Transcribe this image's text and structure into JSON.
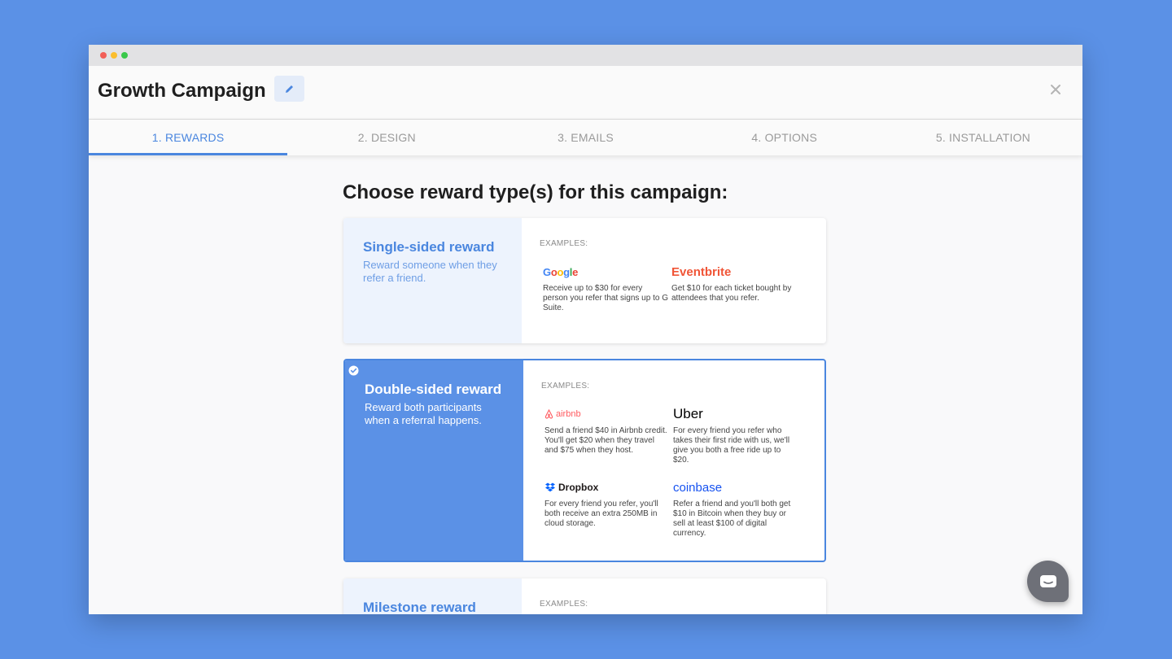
{
  "header": {
    "title": "Growth Campaign"
  },
  "tabs": [
    {
      "label": "1. REWARDS",
      "active": true
    },
    {
      "label": "2. DESIGN"
    },
    {
      "label": "3. EMAILS"
    },
    {
      "label": "4. OPTIONS"
    },
    {
      "label": "5. INSTALLATION"
    }
  ],
  "main": {
    "title": "Choose reward type(s) for this campaign:",
    "cards": [
      {
        "title": "Single-sided reward",
        "desc": "Reward someone when they refer a friend.",
        "examples_label": "EXAMPLES:",
        "examples": [
          {
            "brand": "Google",
            "text": "Receive up to $30 for every person you refer that signs up to G Suite."
          },
          {
            "brand": "Eventbrite",
            "text": "Get $10 for each ticket bought by attendees that you refer."
          }
        ]
      },
      {
        "title": "Double-sided reward",
        "desc": "Reward both participants when a referral happens.",
        "examples_label": "EXAMPLES:",
        "examples": [
          {
            "brand": "airbnb",
            "text": "Send a friend $40 in Airbnb credit. You'll get $20 when they travel and $75 when they host."
          },
          {
            "brand": "Uber",
            "text": "For every friend you refer who takes their first ride with us, we'll give you both a free ride up to $20."
          },
          {
            "brand": "Dropbox",
            "text": "For every friend you refer, you'll both receive an extra 250MB in cloud storage."
          },
          {
            "brand": "coinbase",
            "text": "Refer a friend and you'll both get $10 in Bitcoin when they buy or sell at least $100 of digital currency."
          }
        ]
      },
      {
        "title": "Milestone reward",
        "examples_label": "EXAMPLES:"
      }
    ]
  },
  "colors": {
    "accent": "#4a86df",
    "background": "#5b91e6"
  }
}
